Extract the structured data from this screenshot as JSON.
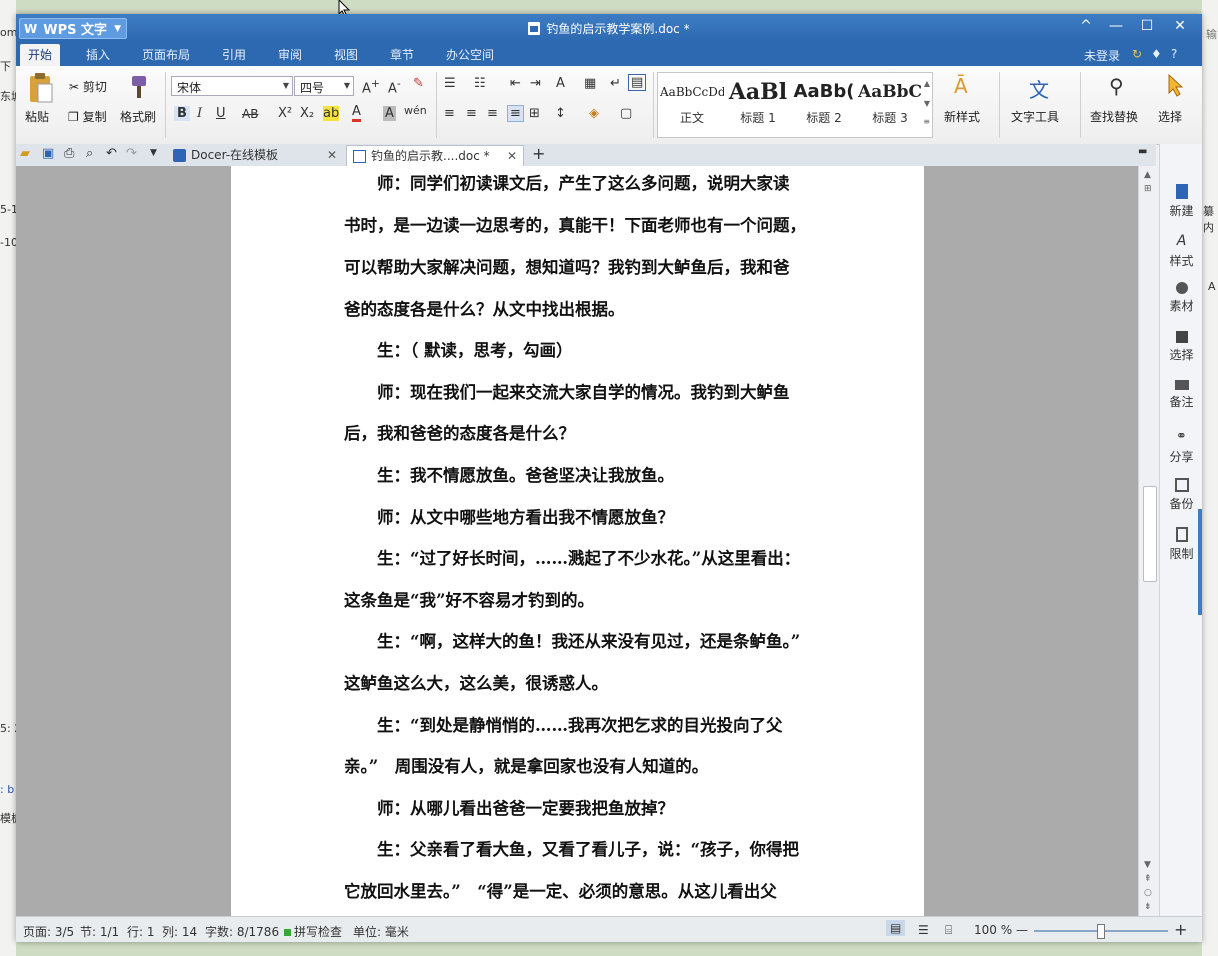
{
  "window": {
    "app_name": "WPS 文字",
    "doc_title": "钓鱼的启示教学案例.doc *",
    "controls": [
      "^",
      "—",
      "☐",
      "✕"
    ]
  },
  "menu": {
    "tabs": [
      "开始",
      "插入",
      "页面布局",
      "引用",
      "审阅",
      "视图",
      "章节",
      "办公空间"
    ],
    "active": "开始",
    "login": "未登录",
    "help": "?"
  },
  "ribbon": {
    "paste": "粘贴",
    "cut": "剪切",
    "copy": "复制",
    "format_painter": "格式刷",
    "font_name": "宋体",
    "font_size": "四号",
    "styles": [
      {
        "preview": "AaBbCcDd",
        "label": "正文"
      },
      {
        "preview": "AaBl",
        "label": "标题 1"
      },
      {
        "preview": "AaBb(",
        "label": "标题 2"
      },
      {
        "preview": "AaBbC",
        "label": "标题 3"
      }
    ],
    "new_style": "新样式",
    "text_tools": "文字工具",
    "find_replace": "查找替换",
    "select": "选择"
  },
  "tabs": [
    {
      "label": "Docer-在线模板",
      "active": false
    },
    {
      "label": "钓鱼的启示教....doc *",
      "active": true
    }
  ],
  "document": {
    "paragraphs": [
      "　　师：同学们初读课文后，产生了这么多问题，说明大家读",
      "书时，是一边读一边思考的，真能干！下面老师也有一个问题，",
      "可以帮助大家解决问题，想知道吗？我钓到大鲈鱼后，我和爸",
      "爸的态度各是什么？从文中找出根据。",
      "　　生：（ 默读，思考，勾画）",
      "　　师：现在我们一起来交流大家自学的情况。我钓到大鲈鱼",
      "后，我和爸爸的态度各是什么？",
      "　　生：我不情愿放鱼。爸爸坚决让我放鱼。",
      "　　师：从文中哪些地方看出我不情愿放鱼？",
      "　　生：“过了好长时间，……溅起了不少水花。”从这里看出：",
      "这条鱼是“我”好不容易才钓到的。",
      "　　生：“啊，这样大的鱼！我还从来没有见过，还是条鲈鱼。”",
      "这鲈鱼这么大，这么美，很诱惑人。",
      "　　生：“到处是静悄悄的……我再次把乞求的目光投向了父",
      "亲。”　周围没有人，就是拿回家也没有人知道的。",
      "　　师：从哪儿看出爸爸一定要我把鱼放掉？",
      "　　生：父亲看了看大鱼，又看了看儿子，说：“孩子，你得把",
      "它放回水里去。”　“得”是一定、必须的意思。从这儿看出父"
    ]
  },
  "right_panel": [
    "新建",
    "样式",
    "素材",
    "选择",
    "备注",
    "分享",
    "备份",
    "限制"
  ],
  "status": {
    "page": "页面: 3/5",
    "section": "节: 1/1",
    "line": "行: 1",
    "column": "列: 14",
    "word_count": "字数: 8/1786",
    "spell_check": "拼写检查",
    "unit": "单位: 毫米",
    "zoom": "100 %",
    "zoom_level": 0.5
  },
  "background": {
    "fragments": [
      "om",
      "下",
      "东城",
      "5-1",
      "-10",
      "5: 2",
      ": b",
      "模板",
      "输",
      "纂内",
      "A"
    ]
  },
  "colors": {
    "title_bar": "#2d69b0",
    "accent": "#3d7cc4"
  }
}
